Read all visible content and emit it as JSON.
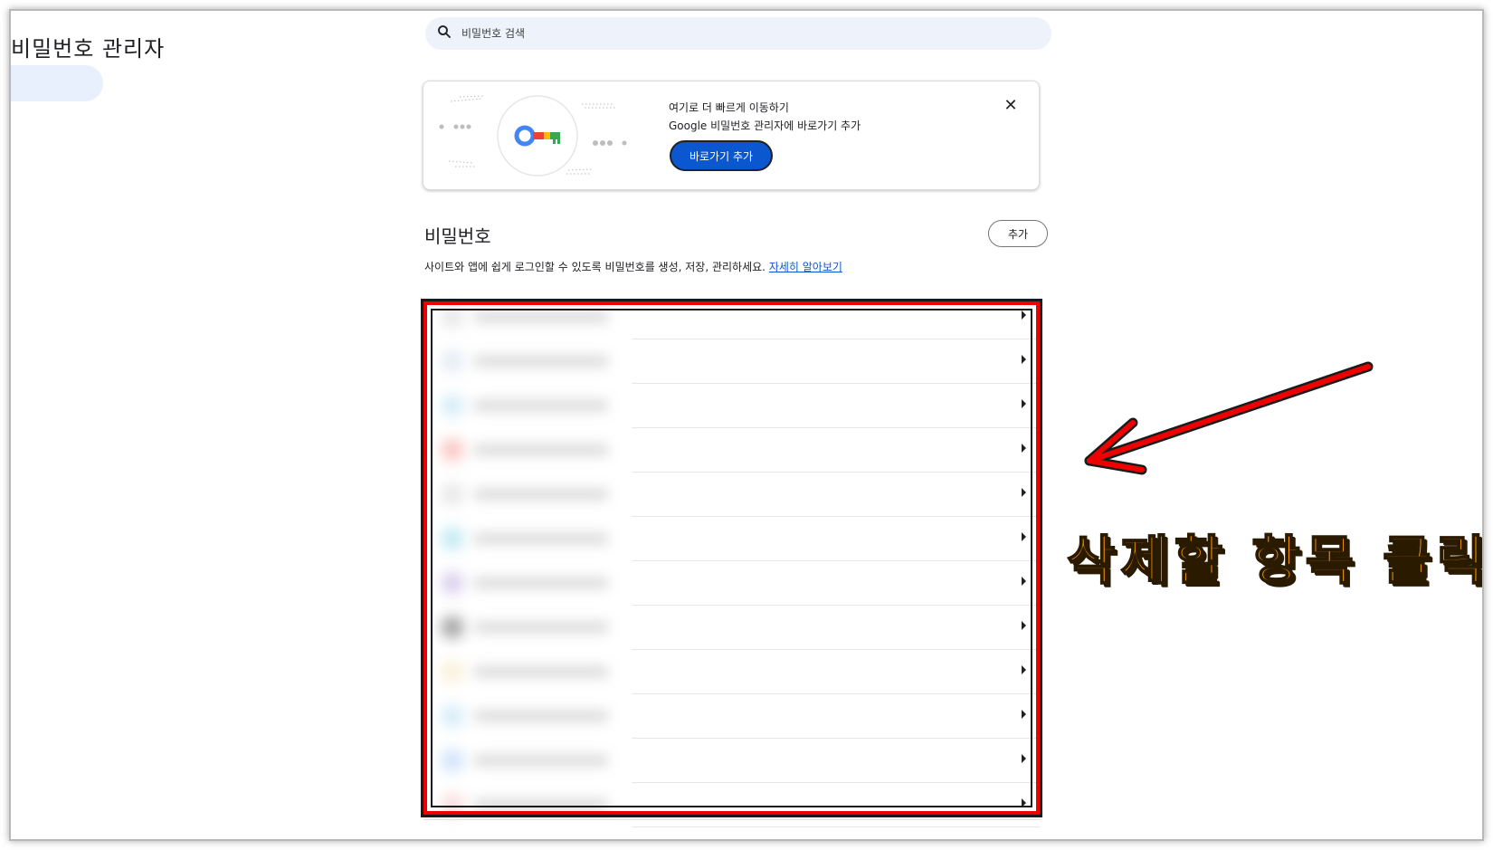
{
  "app": {
    "title": "비밀번호 관리자"
  },
  "search": {
    "placeholder": "비밀번호 검색"
  },
  "promo": {
    "heading": "여기로 더 빠르게 이동하기",
    "subtext": "Google 비밀번호 관리자에 바로가기 추가",
    "button_label": "바로가기 추가",
    "close_icon": "close-icon"
  },
  "passwords": {
    "title": "비밀번호",
    "add_label": "추가",
    "description": "사이트와 앱에 쉽게 로그인할 수 있도록 비밀번호를 생성, 저장, 관리하세요.",
    "learn_more": "자세히 알아보기",
    "rows": [
      {
        "favicon_color": "#d0d0d0"
      },
      {
        "favicon_color": "#c9d6e8"
      },
      {
        "favicon_color": "#a8d8f0"
      },
      {
        "favicon_color": "#f28b82"
      },
      {
        "favicon_color": "#d0d0d0"
      },
      {
        "favicon_color": "#7fd3e8"
      },
      {
        "favicon_color": "#b39ddb"
      },
      {
        "favicon_color": "#444444"
      },
      {
        "favicon_color": "#f5e0b0"
      },
      {
        "favicon_color": "#a8d8f0"
      },
      {
        "favicon_color": "#9ec5f5"
      },
      {
        "favicon_color": "#f4b8b8"
      }
    ]
  },
  "annotation": {
    "callout_text": "삭제할 항목 클릭",
    "highlight_color": "#ee0000",
    "callout_color": "#ff9d00"
  }
}
